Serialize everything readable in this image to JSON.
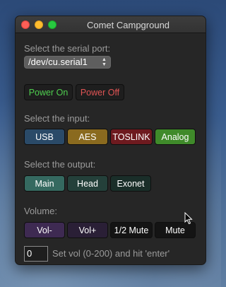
{
  "window": {
    "title": "Comet Campground"
  },
  "serial": {
    "label": "Select the serial port:",
    "selected": "/dev/cu.serial1"
  },
  "power": {
    "on_label": "Power On",
    "off_label": "Power Off",
    "on_color": "#4fcf4f",
    "off_color": "#e05454"
  },
  "input": {
    "label": "Select the input:",
    "buttons": [
      "USB",
      "AES",
      "TOSLINK",
      "Analog"
    ],
    "colors": [
      "#2a4a68",
      "#8a6a1f",
      "#6e1a1f",
      "#3f8a2a"
    ]
  },
  "output": {
    "label": "Select the output:",
    "buttons": [
      "Main",
      "Head",
      "Exonet"
    ],
    "colors": [
      "#356960",
      "#24403a",
      "#1a2e29"
    ]
  },
  "volume": {
    "label": "Volume:",
    "buttons": [
      "Vol-",
      "Vol+",
      "1/2 Mute",
      "Mute"
    ],
    "value": "0",
    "hint": "Set vol (0-200) and hit 'enter'"
  }
}
